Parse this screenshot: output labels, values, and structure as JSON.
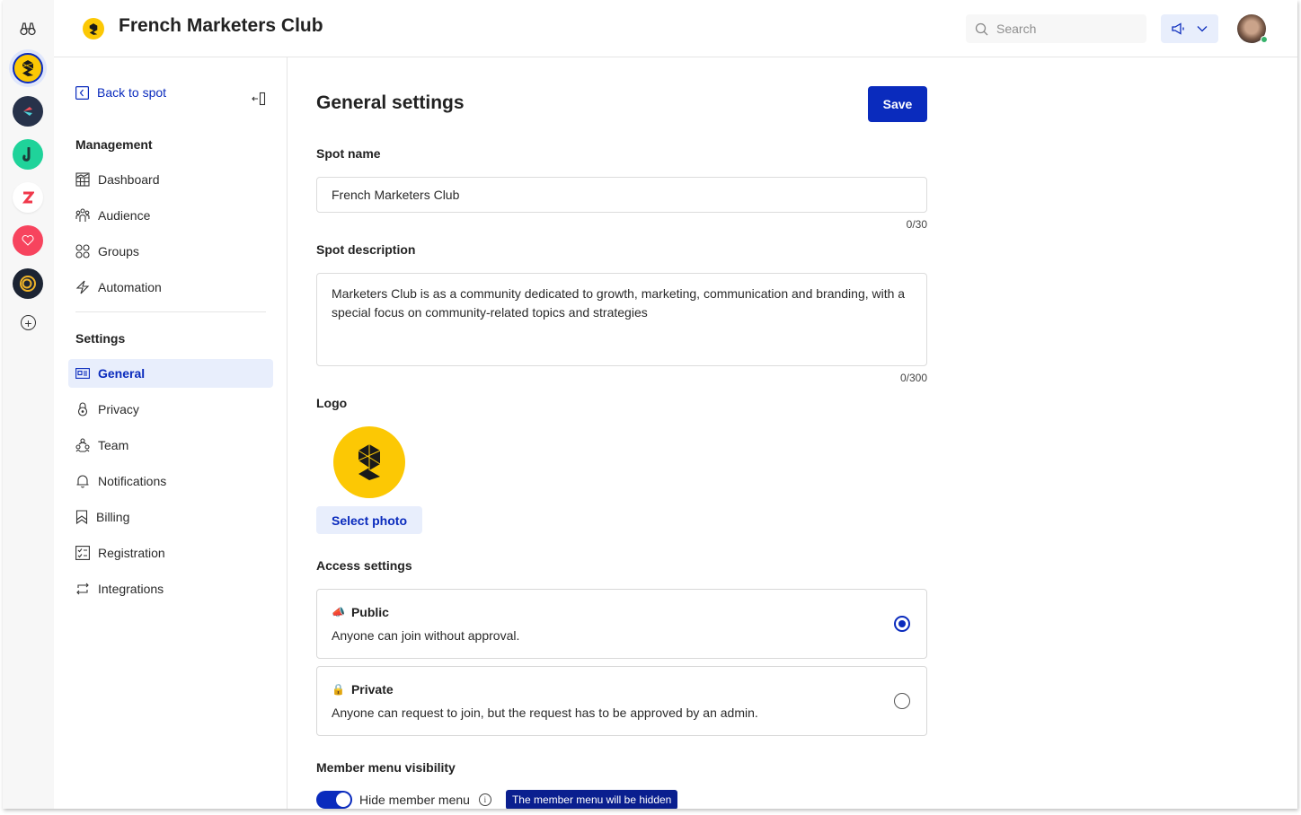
{
  "app": {
    "spot_name": "French Marketers Club",
    "brand_color": "#0a2bbd",
    "logo_color": "#fcc804"
  },
  "rail": {
    "top_icon": "binoculars-icon",
    "workspaces": [
      {
        "name": "french-marketers-club",
        "color": "#fcc804",
        "active": true
      },
      {
        "name": "workspace-2",
        "color": "#27324a",
        "active": false
      },
      {
        "name": "workspace-3",
        "color": "#1fd39a",
        "active": false
      },
      {
        "name": "workspace-4",
        "color": "#ffffff",
        "active": false
      },
      {
        "name": "workspace-5",
        "color": "#f7445e",
        "active": false
      },
      {
        "name": "workspace-6",
        "color": "#1c2433",
        "active": false
      }
    ],
    "add_icon": "plus-circle-icon"
  },
  "header": {
    "title": "French Marketers Club",
    "search_placeholder": "Search",
    "announce_icon": "megaphone-icon",
    "user_status": "online"
  },
  "sidebar": {
    "back_label": "Back to spot",
    "management_title": "Management",
    "management_items": [
      {
        "label": "Dashboard",
        "icon": "dashboard-icon"
      },
      {
        "label": "Audience",
        "icon": "audience-icon"
      },
      {
        "label": "Groups",
        "icon": "groups-icon"
      },
      {
        "label": "Automation",
        "icon": "lightning-icon"
      }
    ],
    "settings_title": "Settings",
    "settings_items": [
      {
        "label": "General",
        "icon": "id-card-icon",
        "active": true
      },
      {
        "label": "Privacy",
        "icon": "lock-icon"
      },
      {
        "label": "Team",
        "icon": "team-icon"
      },
      {
        "label": "Notifications",
        "icon": "bell-icon"
      },
      {
        "label": "Billing",
        "icon": "bookmark-icon"
      },
      {
        "label": "Registration",
        "icon": "checklist-icon"
      },
      {
        "label": "Integrations",
        "icon": "sync-icon"
      }
    ]
  },
  "main": {
    "title": "General settings",
    "save_label": "Save",
    "spot_name_label": "Spot name",
    "spot_name_value": "French Marketers Club",
    "spot_name_counter": "0/30",
    "description_label": "Spot description",
    "description_value": "Marketers Club is as a community dedicated to growth, marketing, communication and branding, with a special focus on community-related topics and strategies",
    "description_counter": "0/300",
    "logo_label": "Logo",
    "select_photo_label": "Select photo",
    "access_label": "Access settings",
    "access_options": [
      {
        "emoji": "📣",
        "title": "Public",
        "description": "Anyone can join without approval.",
        "selected": true
      },
      {
        "emoji": "🔒",
        "title": "Private",
        "description": "Anyone can request to join, but the request has to be approved by an admin.",
        "selected": false
      }
    ],
    "member_menu_label": "Member menu visibility",
    "hide_member_menu_label": "Hide member menu",
    "hide_member_menu_on": true,
    "tooltip": "The member menu will be hidden"
  }
}
